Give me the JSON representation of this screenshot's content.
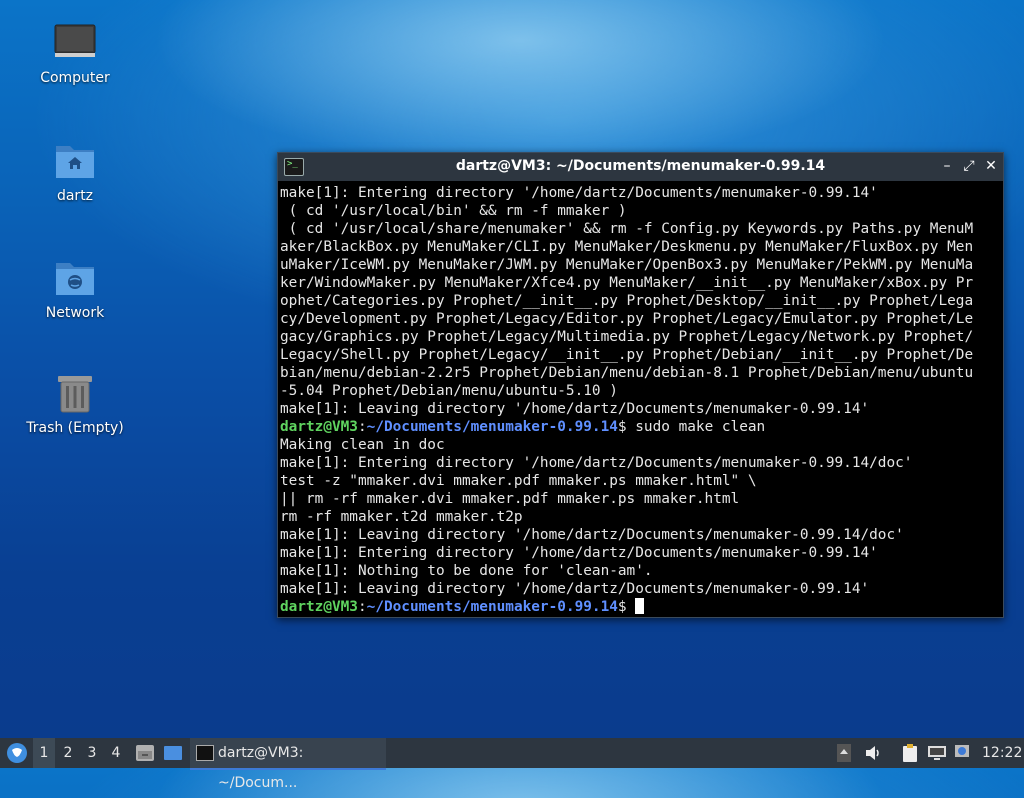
{
  "desktop": {
    "icons": [
      {
        "label": "Computer"
      },
      {
        "label": "dartz"
      },
      {
        "label": "Network"
      },
      {
        "label": "Trash (Empty)"
      }
    ]
  },
  "terminal": {
    "title": "dartz@VM3: ~/Documents/menumaker-0.99.14",
    "controls": {
      "minimize": "–",
      "maximize": "⤢",
      "close": "✕"
    },
    "lines": [
      "make[1]: Entering directory '/home/dartz/Documents/menumaker-0.99.14'",
      " ( cd '/usr/local/bin' && rm -f mmaker )",
      " ( cd '/usr/local/share/menumaker' && rm -f Config.py Keywords.py Paths.py MenuM",
      "aker/BlackBox.py MenuMaker/CLI.py MenuMaker/Deskmenu.py MenuMaker/FluxBox.py Men",
      "uMaker/IceWM.py MenuMaker/JWM.py MenuMaker/OpenBox3.py MenuMaker/PekWM.py MenuMa",
      "ker/WindowMaker.py MenuMaker/Xfce4.py MenuMaker/__init__.py MenuMaker/xBox.py Pr",
      "ophet/Categories.py Prophet/__init__.py Prophet/Desktop/__init__.py Prophet/Lega",
      "cy/Development.py Prophet/Legacy/Editor.py Prophet/Legacy/Emulator.py Prophet/Le",
      "gacy/Graphics.py Prophet/Legacy/Multimedia.py Prophet/Legacy/Network.py Prophet/",
      "Legacy/Shell.py Prophet/Legacy/__init__.py Prophet/Debian/__init__.py Prophet/De",
      "bian/menu/debian-2.2r5 Prophet/Debian/menu/debian-8.1 Prophet/Debian/menu/ubuntu",
      "-5.04 Prophet/Debian/menu/ubuntu-5.10 )",
      "make[1]: Leaving directory '/home/dartz/Documents/menumaker-0.99.14'",
      "",
      "Making clean in doc",
      "make[1]: Entering directory '/home/dartz/Documents/menumaker-0.99.14/doc'",
      "test -z \"mmaker.dvi mmaker.pdf mmaker.ps mmaker.html\" \\",
      "|| rm -rf mmaker.dvi mmaker.pdf mmaker.ps mmaker.html",
      "rm -rf mmaker.t2d mmaker.t2p",
      "make[1]: Leaving directory '/home/dartz/Documents/menumaker-0.99.14/doc'",
      "make[1]: Entering directory '/home/dartz/Documents/menumaker-0.99.14'",
      "make[1]: Nothing to be done for 'clean-am'.",
      "make[1]: Leaving directory '/home/dartz/Documents/menumaker-0.99.14'"
    ],
    "prompt1": {
      "user": "dartz@VM3",
      "sep": ":",
      "path": "~/Documents/menumaker-0.99.14",
      "dollar": "$",
      "command": " sudo make clean"
    },
    "prompt2": {
      "user": "dartz@VM3",
      "sep": ":",
      "path": "~/Documents/menumaker-0.99.14",
      "dollar": "$ "
    }
  },
  "taskbar": {
    "workspaces": [
      "1",
      "2",
      "3",
      "4"
    ],
    "task_label": "dartz@VM3: ~/Docum...",
    "clock": "12:22"
  },
  "colors": {
    "taskbar_bg": "#2d3640",
    "prompt_user": "#5fd35f",
    "prompt_path": "#5f8fff",
    "accent": "#3d7ad6"
  }
}
